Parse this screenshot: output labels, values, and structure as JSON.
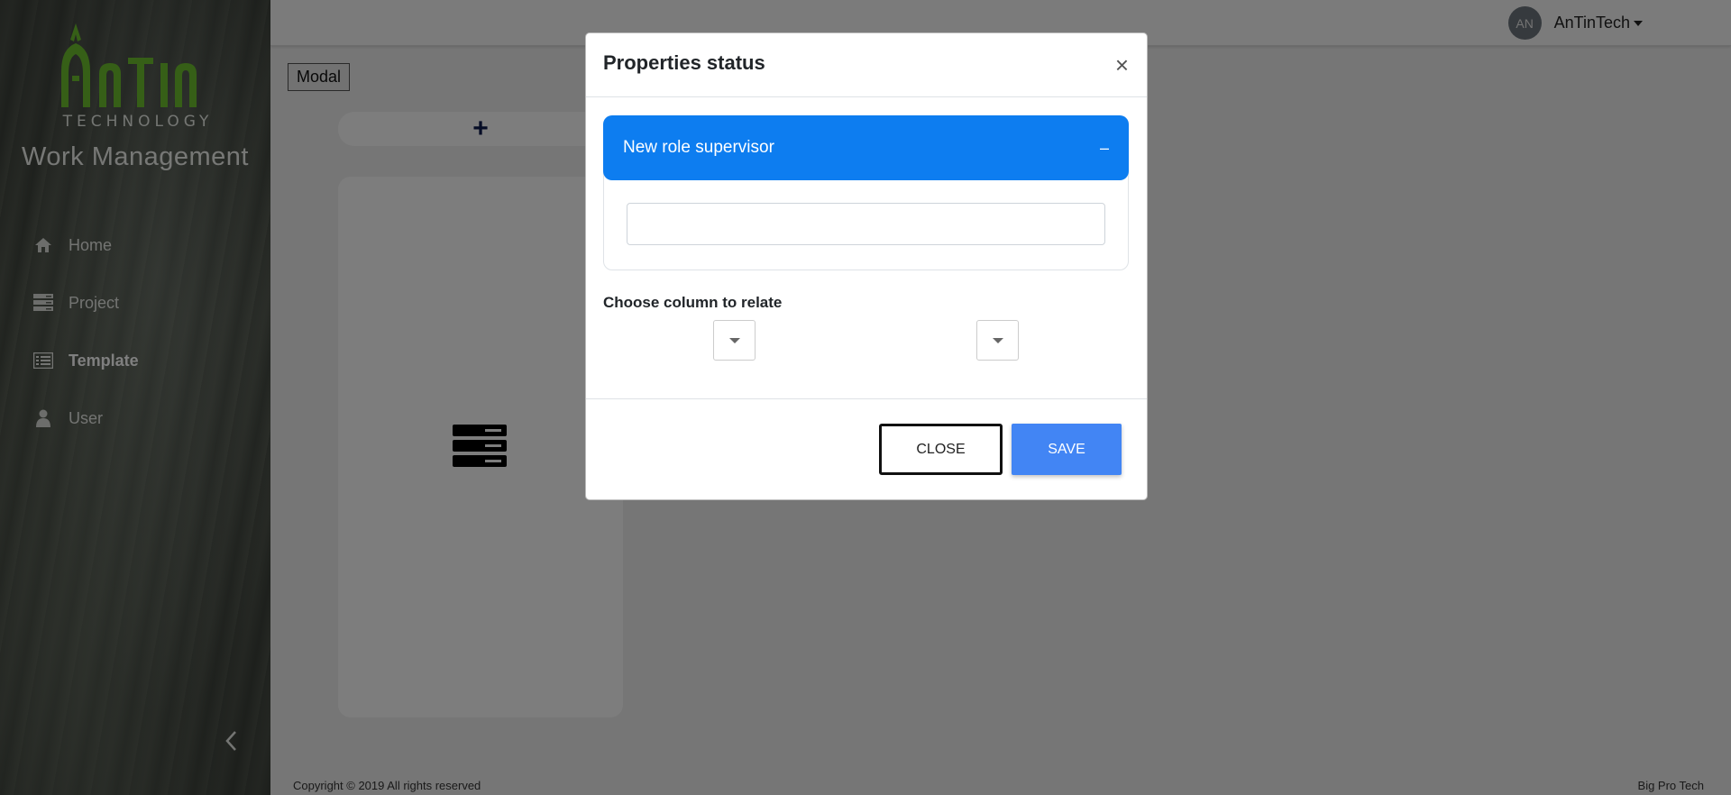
{
  "sidebar": {
    "logo_text": "AnTin",
    "logo_sub": "TECHNOLOGY",
    "app_title": "Work Management",
    "items": [
      {
        "label": "Home",
        "icon": "home-icon"
      },
      {
        "label": "Project",
        "icon": "server-icon"
      },
      {
        "label": "Template",
        "icon": "list-icon",
        "active": true
      },
      {
        "label": "User",
        "icon": "user-icon"
      }
    ]
  },
  "topbar": {
    "avatar_initials": "AN",
    "user_name": "AnTinTech"
  },
  "main": {
    "modal_tag": "Modal",
    "add_symbol": "+",
    "footer_left": "Copyright © 2019 All rights reserved",
    "footer_right": "Big Pro Tech"
  },
  "modal": {
    "title": "Properties status",
    "close_symbol": "×",
    "accordion_title": "New role supervisor",
    "accordion_toggle": "–",
    "input_value": "",
    "choose_label": "Choose column to relate",
    "close_label": "CLOSE",
    "save_label": "SAVE"
  },
  "colors": {
    "accordion": "#0d7df0",
    "save_button": "#4285f4",
    "logo_green": "#6cbf2e"
  }
}
